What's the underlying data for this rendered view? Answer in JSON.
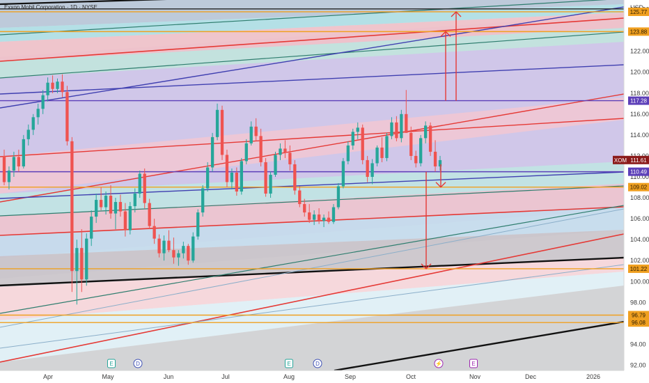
{
  "header": {
    "title": "Exxon Mobil Corporation · 1D · NYSE",
    "currency": "USD"
  },
  "chart_data": {
    "type": "candlestick",
    "symbol": "XOM",
    "price_scale": {
      "min": 91.5,
      "max": 126.9,
      "ticks": [
        "92.00",
        "94.00",
        "96.00",
        "98.00",
        "100.00",
        "102.00",
        "104.00",
        "106.00",
        "108.00",
        "110.00",
        "112.00",
        "114.00",
        "116.00",
        "118.00",
        "120.00",
        "122.00",
        "124.00",
        "126.00"
      ]
    },
    "time_axis": {
      "labels": [
        "Apr",
        "May",
        "Jun",
        "Jul",
        "Aug",
        "Sep",
        "Oct",
        "Nov",
        "Dec",
        "2026"
      ]
    },
    "price_tags": [
      {
        "text": "125.77",
        "value": 125.77,
        "color": "#f0a020"
      },
      {
        "text": "123.88",
        "value": 123.88,
        "color": "#f0a020"
      },
      {
        "text": "117.28",
        "value": 117.28,
        "color": "#5c3fb8"
      },
      {
        "text": "XOM",
        "value": 111.61,
        "color": "#8b1a1a",
        "is_symbol": true
      },
      {
        "text": "111.61",
        "value": 111.61,
        "color": "#8b1a1a"
      },
      {
        "text": "110.49",
        "value": 110.49,
        "color": "#5c3fb8"
      },
      {
        "text": "109.02",
        "value": 109.02,
        "color": "#f0a020"
      },
      {
        "text": "101.22",
        "value": 101.22,
        "color": "#f0a020"
      },
      {
        "text": "96.79",
        "value": 96.79,
        "color": "#f0a020"
      },
      {
        "text": "96.08",
        "value": 96.08,
        "color": "#f0a020"
      }
    ],
    "horizontal_levels": [
      {
        "value": 125.77,
        "color": "#f0a020"
      },
      {
        "value": 126.05,
        "color": "#222222"
      },
      {
        "value": 123.88,
        "color": "#f0a020"
      },
      {
        "value": 117.28,
        "color": "#5c3fb8"
      },
      {
        "value": 110.49,
        "color": "#5c3fb8"
      },
      {
        "value": 109.02,
        "color": "#f0a020"
      },
      {
        "value": 101.22,
        "color": "#f0a020"
      },
      {
        "value": 96.79,
        "color": "#f0a020"
      },
      {
        "value": 96.08,
        "color": "#f0a020"
      }
    ],
    "candles_ohlc": [
      [
        112.0,
        112.6,
        109.2,
        109.5
      ],
      [
        109.5,
        111.0,
        108.8,
        110.6
      ],
      [
        110.6,
        112.4,
        110.0,
        111.9
      ],
      [
        111.9,
        112.6,
        110.5,
        111.0
      ],
      [
        111.0,
        114.0,
        110.8,
        113.6
      ],
      [
        113.6,
        115.0,
        113.0,
        114.5
      ],
      [
        114.5,
        116.0,
        114.0,
        115.7
      ],
      [
        115.7,
        117.0,
        115.0,
        116.5
      ],
      [
        116.5,
        118.3,
        116.0,
        117.8
      ],
      [
        117.8,
        119.5,
        117.2,
        119.0
      ],
      [
        119.0,
        119.7,
        118.0,
        118.4
      ],
      [
        118.4,
        119.4,
        118.0,
        119.1
      ],
      [
        119.1,
        119.8,
        117.6,
        118.1
      ],
      [
        118.1,
        118.7,
        113.0,
        113.4
      ],
      [
        113.4,
        113.8,
        99.0,
        101.0
      ],
      [
        101.0,
        104.0,
        97.8,
        103.2
      ],
      [
        103.2,
        105.0,
        99.0,
        100.2
      ],
      [
        100.2,
        104.6,
        99.6,
        104.1
      ],
      [
        104.1,
        106.8,
        103.4,
        106.2
      ],
      [
        106.2,
        108.4,
        105.6,
        107.8
      ],
      [
        107.8,
        109.0,
        106.8,
        107.1
      ],
      [
        107.1,
        108.6,
        106.4,
        108.2
      ],
      [
        108.2,
        109.2,
        106.0,
        106.5
      ],
      [
        106.5,
        108.0,
        105.0,
        107.6
      ],
      [
        107.6,
        108.3,
        106.2,
        106.7
      ],
      [
        106.7,
        107.5,
        104.3,
        104.9
      ],
      [
        104.9,
        107.6,
        104.5,
        107.2
      ],
      [
        107.2,
        108.9,
        106.6,
        108.4
      ],
      [
        108.4,
        110.6,
        108.0,
        110.3
      ],
      [
        110.3,
        110.8,
        107.0,
        107.5
      ],
      [
        107.5,
        107.9,
        105.0,
        105.3
      ],
      [
        105.3,
        106.0,
        103.6,
        104.1
      ],
      [
        104.1,
        104.5,
        102.3,
        102.7
      ],
      [
        102.7,
        104.4,
        102.0,
        103.9
      ],
      [
        103.9,
        104.9,
        102.8,
        103.0
      ],
      [
        103.0,
        104.2,
        101.7,
        102.3
      ],
      [
        102.3,
        103.0,
        101.5,
        102.7
      ],
      [
        102.7,
        103.8,
        102.2,
        103.4
      ],
      [
        103.4,
        103.6,
        101.6,
        102.0
      ],
      [
        102.0,
        104.7,
        101.8,
        104.3
      ],
      [
        104.3,
        106.9,
        104.0,
        106.6
      ],
      [
        106.6,
        109.2,
        106.2,
        108.9
      ],
      [
        108.9,
        111.4,
        108.6,
        110.9
      ],
      [
        110.9,
        114.2,
        110.5,
        113.8
      ],
      [
        113.8,
        117.0,
        113.5,
        116.4
      ],
      [
        116.4,
        116.8,
        111.6,
        112.1
      ],
      [
        112.1,
        112.6,
        109.0,
        109.5
      ],
      [
        109.5,
        110.8,
        108.8,
        110.4
      ],
      [
        110.4,
        110.9,
        108.2,
        108.6
      ],
      [
        108.6,
        111.8,
        108.3,
        111.5
      ],
      [
        111.5,
        113.6,
        111.2,
        113.2
      ],
      [
        113.2,
        115.3,
        113.0,
        114.8
      ],
      [
        114.8,
        115.6,
        113.4,
        113.9
      ],
      [
        113.9,
        114.6,
        111.0,
        111.4
      ],
      [
        111.4,
        111.8,
        108.1,
        108.4
      ],
      [
        108.4,
        110.5,
        108.0,
        110.2
      ],
      [
        110.2,
        112.4,
        110.0,
        112.1
      ],
      [
        112.1,
        113.2,
        111.6,
        112.7
      ],
      [
        112.7,
        113.5,
        111.8,
        112.3
      ],
      [
        112.3,
        113.0,
        110.6,
        111.2
      ],
      [
        111.2,
        111.6,
        108.3,
        108.7
      ],
      [
        108.7,
        109.1,
        107.1,
        107.4
      ],
      [
        107.4,
        107.9,
        106.2,
        106.6
      ],
      [
        106.6,
        107.4,
        105.6,
        105.9
      ],
      [
        105.9,
        106.8,
        105.4,
        106.4
      ],
      [
        106.4,
        107.0,
        105.5,
        105.8
      ],
      [
        105.8,
        106.4,
        105.2,
        106.1
      ],
      [
        106.1,
        106.7,
        105.5,
        105.7
      ],
      [
        105.7,
        107.4,
        105.5,
        107.1
      ],
      [
        107.1,
        109.4,
        106.9,
        109.1
      ],
      [
        109.1,
        111.8,
        108.9,
        111.5
      ],
      [
        111.5,
        113.4,
        111.2,
        113.0
      ],
      [
        113.0,
        114.6,
        112.6,
        114.3
      ],
      [
        114.3,
        115.2,
        113.6,
        114.7
      ],
      [
        114.7,
        115.0,
        111.2,
        111.6
      ],
      [
        111.6,
        112.0,
        109.5,
        110.0
      ],
      [
        110.0,
        111.7,
        109.3,
        111.3
      ],
      [
        111.3,
        113.0,
        111.0,
        112.8
      ],
      [
        112.8,
        113.8,
        111.4,
        111.8
      ],
      [
        111.8,
        114.2,
        111.5,
        113.9
      ],
      [
        113.9,
        115.7,
        113.6,
        115.2
      ],
      [
        115.2,
        115.8,
        113.4,
        113.7
      ],
      [
        113.7,
        116.4,
        113.3,
        116.0
      ],
      [
        116.0,
        118.3,
        115.6,
        114.2
      ],
      [
        114.2,
        114.8,
        111.6,
        112.0
      ],
      [
        112.0,
        112.5,
        110.9,
        111.3
      ],
      [
        111.3,
        114.0,
        111.0,
        113.7
      ],
      [
        113.7,
        115.3,
        113.2,
        114.9
      ],
      [
        114.9,
        115.2,
        112.0,
        112.4
      ],
      [
        112.4,
        113.5,
        110.5,
        111.0
      ],
      [
        111.0,
        112.0,
        110.6,
        111.6
      ]
    ],
    "candle_colors": {
      "up": "#26a69a",
      "down": "#ef5350"
    },
    "markers": [
      {
        "label": "E",
        "type": "earnings",
        "date": "May"
      },
      {
        "label": "D",
        "type": "dividend",
        "date": "May"
      },
      {
        "label": "E",
        "type": "earnings",
        "date": "Aug"
      },
      {
        "label": "D",
        "type": "dividend",
        "date": "Aug"
      },
      {
        "label": "⚡",
        "type": "split",
        "date": "Oct"
      },
      {
        "label": "E",
        "type": "earnings",
        "date": "Oct"
      }
    ],
    "projections": [
      {
        "direction": "up",
        "from": 117.28,
        "to": 125.77,
        "color": "#e53935"
      },
      {
        "direction": "up",
        "from": 117.28,
        "to": 123.88,
        "color": "#e53935"
      },
      {
        "direction": "down",
        "from": 110.49,
        "to": 101.22,
        "color": "#e53935"
      },
      {
        "direction": "down",
        "from": 111.2,
        "to": 109.02,
        "color": "#e53935"
      }
    ]
  }
}
